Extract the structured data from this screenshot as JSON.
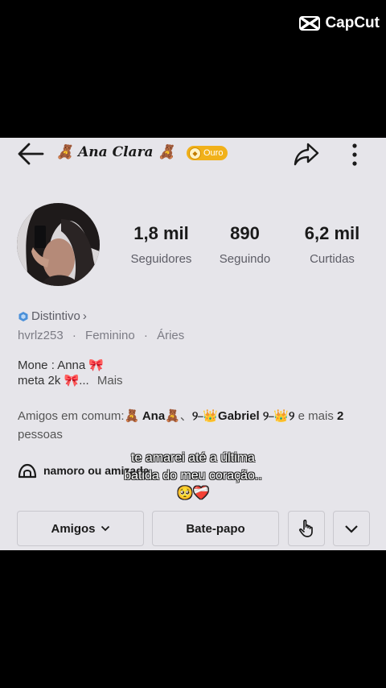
{
  "watermark": {
    "label": "CapCut"
  },
  "header": {
    "title": "🧸 Ana Clara 🧸",
    "badge": "Ouro"
  },
  "profile": {
    "stats": [
      {
        "value": "1,8 mil",
        "label": "Seguidores"
      },
      {
        "value": "890",
        "label": "Seguindo"
      },
      {
        "value": "6,2 mil",
        "label": "Curtidas"
      }
    ],
    "distintivo": "Distintivo",
    "distintivo_chevron": "›",
    "username": "hvrlz253",
    "gender": "Feminino",
    "sign": "Áries",
    "separator": "·",
    "bio_line1": "Mone : Anna 🎀",
    "bio_line2": "meta 2k 🎀...",
    "bio_more": "Mais",
    "mutual_prefix": "Amigos em comum:",
    "mutual_friend1": "🧸 Ana🧸",
    "mutual_sep": "、",
    "mutual_friend2": "୨⎯👑Gabriel ୨⎯👑୨",
    "mutual_suffix": "e mais",
    "mutual_count": "2",
    "mutual_line2": "pessoas",
    "relationship": "namoro ou amizade"
  },
  "subtitle": {
    "line1": "te amarei até a última",
    "line2": "batida do meu coração..",
    "line3": "🥺❤️‍🩹"
  },
  "actions": {
    "friends": "Amigos",
    "chat": "Bate-papo"
  },
  "colors": {
    "screen_bg": "#e6e5ea",
    "badge_gold": "#f1b11a",
    "distintivo_blue": "#4a90d9"
  }
}
